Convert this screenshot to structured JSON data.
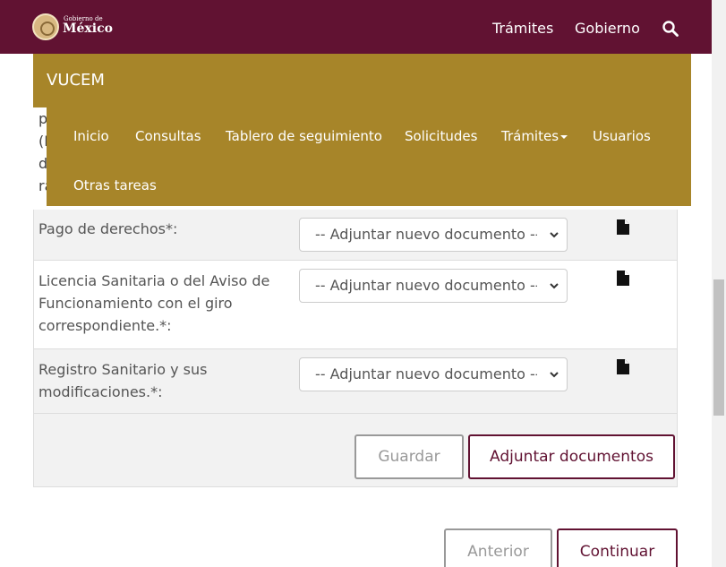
{
  "header": {
    "logo_small": "Gobierno de",
    "logo_big": "México",
    "nav": [
      {
        "label": "Trámites"
      },
      {
        "label": "Gobierno"
      }
    ],
    "search_icon": "search-icon",
    "bg_color": "#611232"
  },
  "vucem": {
    "title": "VUCEM",
    "bg_color": "#a78529",
    "menu": [
      {
        "label": "Inicio"
      },
      {
        "label": "Consultas"
      },
      {
        "label": "Tablero de seguimiento"
      },
      {
        "label": "Solicitudes"
      },
      {
        "label": "Trámites"
      },
      {
        "label": "Usuarios"
      },
      {
        "label": "Otras tareas"
      }
    ]
  },
  "clipped_fragments": [
    "p",
    "(I",
    "d",
    "ra"
  ],
  "documents": {
    "rows": [
      {
        "label": "Pago de derechos*:",
        "select_value": "-- Adjuntar nuevo documento --",
        "icon": "file-icon"
      },
      {
        "label": "Licencia Sanitaria o del Aviso de Funcionamiento con el giro correspondiente.*:",
        "select_value": "-- Adjuntar nuevo documento --",
        "icon": "file-icon"
      },
      {
        "label": "Registro Sanitario y sus modificaciones.*:",
        "select_value": "-- Adjuntar nuevo documento --",
        "icon": "file-icon"
      }
    ],
    "save_label": "Guardar",
    "attach_label": "Adjuntar documentos"
  },
  "footer": {
    "prev_label": "Anterior",
    "next_label": "Continuar"
  }
}
